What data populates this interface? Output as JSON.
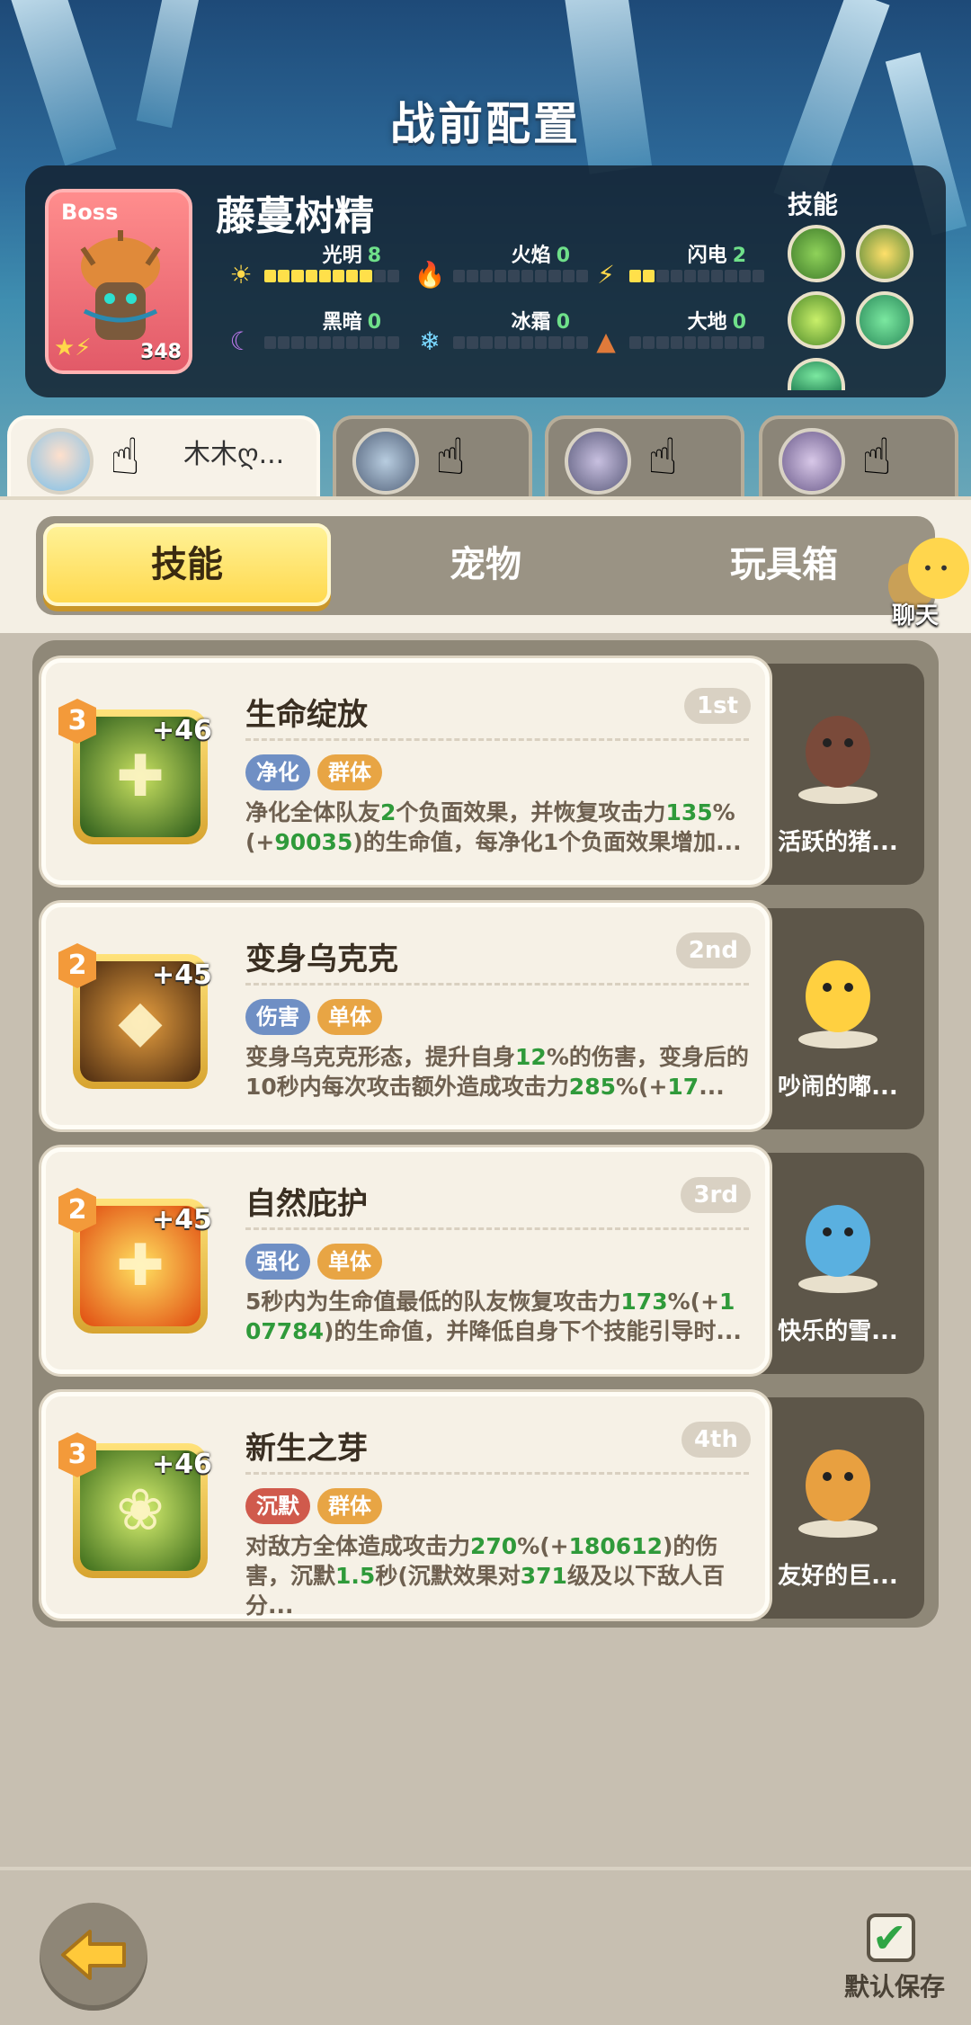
{
  "header": {
    "title": "战前配置",
    "boss": {
      "tag": "Boss",
      "name": "藤蔓树精",
      "level": "348",
      "skills_label": "技能"
    },
    "elements": [
      {
        "label": "光明",
        "value": "8",
        "icon": "sun-icon",
        "filled": 8
      },
      {
        "label": "火焰",
        "value": "0",
        "icon": "flame-icon",
        "filled": 0
      },
      {
        "label": "闪电",
        "value": "2",
        "icon": "lightning-icon",
        "filled": 2
      },
      {
        "label": "黑暗",
        "value": "0",
        "icon": "moon-icon",
        "filled": 0
      },
      {
        "label": "冰霜",
        "value": "0",
        "icon": "snowflake-icon",
        "filled": 0
      },
      {
        "label": "大地",
        "value": "0",
        "icon": "earth-icon",
        "filled": 0
      }
    ]
  },
  "team": {
    "active_player_name": "木木ღ..."
  },
  "tabs": {
    "skills": "技能",
    "pets": "宠物",
    "toybox": "玩具箱",
    "chat": "聊天"
  },
  "skills": [
    {
      "level": "3",
      "plus": "+46",
      "title": "生命绽放",
      "rank": "1st",
      "tags": [
        "净化",
        "群体"
      ],
      "tag_colors": [
        "blue",
        "gold"
      ],
      "desc_parts": [
        {
          "t": "净化全体队友"
        },
        {
          "t": "2",
          "g": true
        },
        {
          "t": "个负面效果，并恢复攻击力"
        },
        {
          "t": "135",
          "g": true
        },
        {
          "t": "%(+"
        },
        {
          "t": "90035",
          "g": true
        },
        {
          "t": ")的生命值，每净化1个负面效果增加..."
        }
      ],
      "pet_name": "活跃的猪..."
    },
    {
      "level": "2",
      "plus": "+45",
      "title": "变身乌克克",
      "rank": "2nd",
      "tags": [
        "伤害",
        "单体"
      ],
      "tag_colors": [
        "blue",
        "gold"
      ],
      "desc_parts": [
        {
          "t": "变身乌克克形态，提升自身"
        },
        {
          "t": "12",
          "g": true
        },
        {
          "t": "%的伤害，变身后的10秒内每次攻击额外造成攻击力"
        },
        {
          "t": "285",
          "g": true
        },
        {
          "t": "%(+"
        },
        {
          "t": "17",
          "g": true
        },
        {
          "t": "..."
        }
      ],
      "pet_name": "吵闹的嘟..."
    },
    {
      "level": "2",
      "plus": "+45",
      "title": "自然庇护",
      "rank": "3rd",
      "tags": [
        "强化",
        "单体"
      ],
      "tag_colors": [
        "blue",
        "gold"
      ],
      "desc_parts": [
        {
          "t": "5秒内为生命值最低的队友恢复攻击力"
        },
        {
          "t": "173",
          "g": true
        },
        {
          "t": "%(+"
        },
        {
          "t": "107784",
          "g": true
        },
        {
          "t": ")的生命值，并降低自身下个技能引导时..."
        }
      ],
      "pet_name": "快乐的雪..."
    },
    {
      "level": "3",
      "plus": "+46",
      "title": "新生之芽",
      "rank": "4th",
      "tags": [
        "沉默",
        "群体"
      ],
      "tag_colors": [
        "red",
        "gold"
      ],
      "desc_parts": [
        {
          "t": "对敌方全体造成攻击力"
        },
        {
          "t": "270",
          "g": true
        },
        {
          "t": "%(+"
        },
        {
          "t": "180612",
          "g": true
        },
        {
          "t": ")的伤害，沉默"
        },
        {
          "t": "1.5",
          "g": true
        },
        {
          "t": "秒(沉默效果对"
        },
        {
          "t": "371",
          "g": true
        },
        {
          "t": "级及以下敌人百分..."
        }
      ],
      "pet_name": "友好的巨..."
    }
  ],
  "footer": {
    "save_label": "默认保存"
  }
}
